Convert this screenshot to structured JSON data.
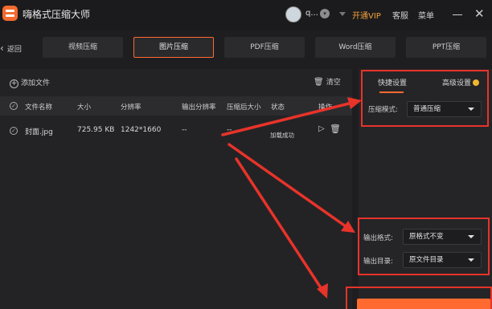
{
  "app": {
    "title": "嗨格式压缩大师"
  },
  "user": {
    "name": "q..."
  },
  "header": {
    "vip_label": "开通VIP",
    "service_label": "客服",
    "menu_label": "菜单"
  },
  "nav": {
    "back_label": "返回",
    "tabs": [
      {
        "label": "视频压缩"
      },
      {
        "label": "图片压缩"
      },
      {
        "label": "PDF压缩"
      },
      {
        "label": "Word压缩"
      },
      {
        "label": "PPT压缩"
      }
    ],
    "active_tab": "图片压缩"
  },
  "toolbar": {
    "add_file_label": "添加文件",
    "clear_label": "清空"
  },
  "table": {
    "headers": [
      "文件名称",
      "大小",
      "分辨率",
      "输出分辨率",
      "压缩后大小",
      "状态",
      "操作"
    ],
    "rows": [
      {
        "name": "封面.jpg",
        "size": "725.95 KB",
        "resolution": "1242*1660",
        "output_resolution": "--",
        "compressed_size": "--",
        "status": "加载成功"
      }
    ]
  },
  "settings": {
    "tabs": [
      {
        "label": "快捷设置"
      },
      {
        "label": "高级设置"
      }
    ],
    "active_tab": "快捷设置",
    "compress_mode": {
      "label": "压缩模式:",
      "value": "普通压缩"
    },
    "output_format": {
      "label": "输出格式:",
      "value": "原格式不变"
    },
    "output_dir": {
      "label": "输出目录:",
      "value": "原文件目录"
    }
  },
  "colors": {
    "accent": "#ff6a30",
    "vip": "#f2a23c",
    "annotation": "#e8332a"
  }
}
